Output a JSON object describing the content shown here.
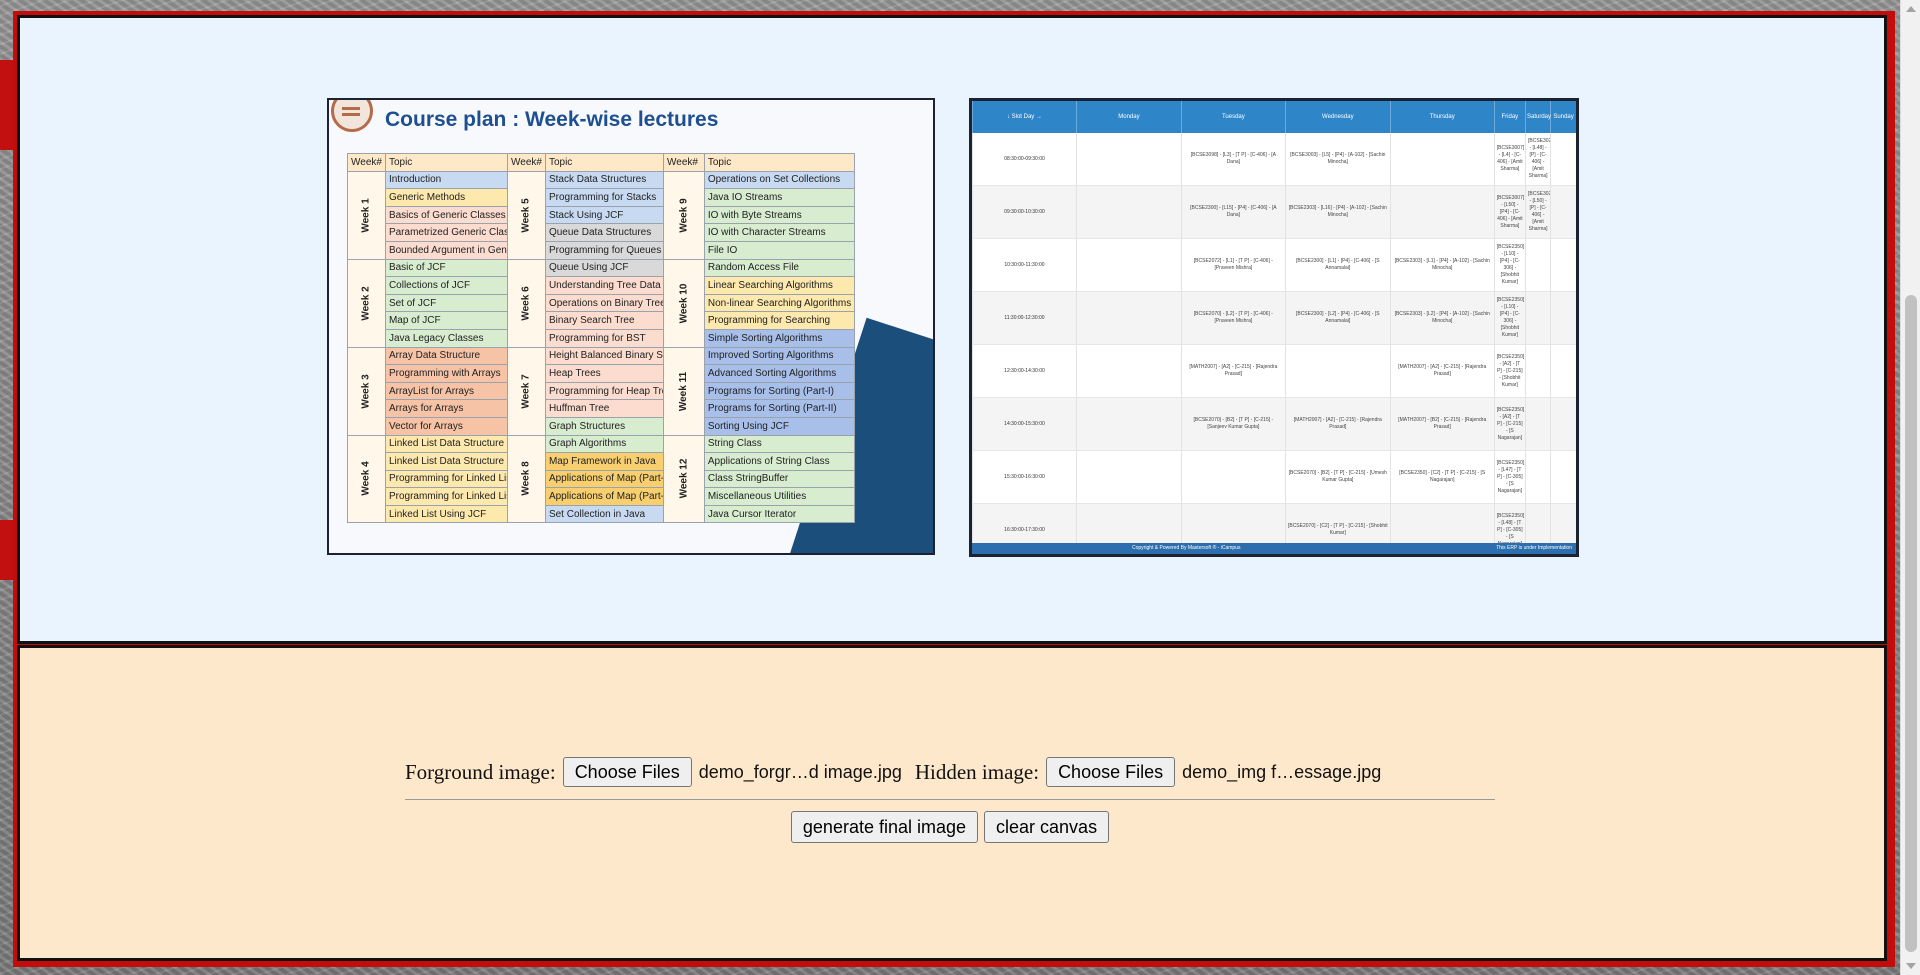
{
  "image_loader": {
    "foreground_label": "Forground image:",
    "hidden_label": "Hidden image:",
    "choose_files_label": "Choose Files",
    "foreground_file": "demo_forgr…d image.jpg",
    "hidden_file": "demo_img f…essage.jpg",
    "generate_label": "generate final image",
    "clear_label": "clear canvas"
  },
  "foreground_picture": {
    "title": "Course plan : Week-wise lectures",
    "header_week": "Week#",
    "header_topic": "Topic",
    "columns": [
      {
        "weeks": [
          {
            "label": "Week 1",
            "topics": [
              "Introduction",
              "Generic Methods",
              "Basics of Generic Classes",
              "Parametrized Generic Classes",
              "Bounded Argument in Generic Classes"
            ],
            "colors": [
              "c-blue",
              "c-yellow",
              "c-peach",
              "c-peach",
              "c-peach"
            ]
          },
          {
            "label": "Week 2",
            "topics": [
              "Basic of JCF",
              "Collections of JCF",
              "Set of JCF",
              "Map of JCF",
              "Java Legacy Classes"
            ],
            "colors": [
              "c-green",
              "c-green",
              "c-green",
              "c-green",
              "c-green"
            ]
          },
          {
            "label": "Week 3",
            "topics": [
              "Array Data Structure",
              "Programming with Arrays",
              "ArrayList for Arrays",
              "Arrays for Arrays",
              "Vector for Arrays"
            ],
            "colors": [
              "c-orange",
              "c-orange",
              "c-orange",
              "c-orange",
              "c-orange"
            ]
          },
          {
            "label": "Week 4",
            "topics": [
              "Linked List Data Structure (Part-I)",
              "Linked List Data Structure (Part-II)",
              "Programming for Linked List (Part-I)",
              "Programming for Linked List (Part-II)",
              "Linked List Using JCF"
            ],
            "colors": [
              "c-yellow",
              "c-yellow",
              "c-yellow",
              "c-yellow",
              "c-yellow"
            ]
          }
        ]
      },
      {
        "weeks": [
          {
            "label": "Week 5",
            "topics": [
              "Stack Data Structures",
              "Programming for Stacks",
              "Stack Using JCF",
              "Queue Data Structures",
              "Programming for Queues"
            ],
            "colors": [
              "c-blue",
              "c-blue",
              "c-blue",
              "c-gray",
              "c-gray"
            ]
          },
          {
            "label": "Week 6",
            "topics": [
              "Queue Using JCF",
              "Understanding Tree Data Structures",
              "Operations on Binary Trees",
              "Binary Search Tree",
              "Programming for BST"
            ],
            "colors": [
              "c-gray",
              "c-peach",
              "c-peach",
              "c-peach",
              "c-peach"
            ]
          },
          {
            "label": "Week 7",
            "topics": [
              "Height Balanced Binary Search Tree",
              "Heap Trees",
              "Programming for Heap Trees",
              "Huffman Tree",
              "Graph Structures"
            ],
            "colors": [
              "c-peach",
              "c-peach",
              "c-peach",
              "c-peach",
              "c-green"
            ]
          },
          {
            "label": "Week 8",
            "topics": [
              "Graph Algorithms",
              "Map Framework in Java",
              "Applications of Map (Part-I)",
              "Applications of Map (Part-II)",
              "Set Collection in Java"
            ],
            "colors": [
              "c-green",
              "c-gold",
              "c-gold",
              "c-gold",
              "c-blue"
            ]
          }
        ]
      },
      {
        "weeks": [
          {
            "label": "Week 9",
            "topics": [
              "Operations on Set Collections",
              "Java IO Streams",
              "IO with Byte Streams",
              "IO with Character Streams",
              "File IO"
            ],
            "colors": [
              "c-blue",
              "c-green",
              "c-green",
              "c-green",
              "c-green"
            ]
          },
          {
            "label": "Week 10",
            "topics": [
              "Random Access File",
              "Linear Searching Algorithms",
              "Non-linear Searching Algorithms",
              "Programming for Searching",
              "Simple Sorting Algorithms"
            ],
            "colors": [
              "c-green",
              "c-yellow",
              "c-yellow",
              "c-yellow",
              "c-royal"
            ]
          },
          {
            "label": "Week 11",
            "topics": [
              "Improved Sorting Algorithms",
              "Advanced Sorting Algorithms",
              "Programs for Sorting (Part-I)",
              "Programs for Sorting (Part-II)",
              "Sorting Using JCF"
            ],
            "colors": [
              "c-royal",
              "c-royal",
              "c-royal",
              "c-royal",
              "c-royal"
            ]
          },
          {
            "label": "Week 12",
            "topics": [
              "String Class",
              "Applications of String Class",
              "Class StringBuffer",
              "Miscellaneous Utilities",
              "Java Cursor Iterator"
            ],
            "colors": [
              "c-green",
              "c-green",
              "c-green",
              "c-green",
              "c-green"
            ]
          }
        ]
      }
    ]
  },
  "hidden_picture": {
    "headers": [
      "↓ Slot Day →",
      "Monday",
      "Tuesday",
      "Wednesday",
      "Thursday",
      "Friday",
      "Saturday",
      "Sunday"
    ],
    "rows": [
      [
        "08:30:00-09:30:00",
        "",
        "[BCSE3098] - [L3] - [T P] - [C-406] - [A Dana]",
        "[BCSE3003] - [L5] - [P4] - [A-102] - [Sachin Minocha]",
        "",
        "[BCSE3007] - [L4] - [C-406] - [Amit Sharma]",
        "[BCSE3020] - [L48] - [P] - [C-406] - [Amit Sharma]",
        ""
      ],
      [
        "09:30:00-10:30:00",
        "",
        "[BCSE2300] - [L15] - [P4] - [C-406] - [A Dana]",
        "[BCSE2303] - [L16] - [P4] - [A-102] - [Sachin Minocha]",
        "",
        "[BCSE3007] - [L50] - [P4] - [C-406] - [Amit Sharma]",
        "[BCSE3020] - [L50] - [P] - [C-406] - [Amit Sharma]",
        ""
      ],
      [
        "10:30:00-11:30:00",
        "",
        "[BCSE2072] - [L1] - [T P] - [C-406] - [Praveen Mishra]",
        "[BCSE2300] - [L1] - [P4] - [C-406] - [S Annamalai]",
        "[BCSE2303] - [L1] - [P4] - [A-102] - [Sachin Minocha]",
        "[BCSE2350] - [L10] - [P4] - [C-306] - [Shobhit Kumar]",
        "",
        ""
      ],
      [
        "11:30:00-12:30:00",
        "",
        "[BCSE2070] - [L2] - [T P] - [C-406] - [Praveen Mishra]",
        "[BCSE2300] - [L2] - [P4] - [C-406] - [S Annamalai]",
        "[BCSE2303] - [L2] - [P4] - [A-102] - [Sachin Minocha]",
        "[BCSE2350] - [L10] - [P4] - [C-306] - [Shobhit Kumar]",
        "",
        ""
      ],
      [
        "12:30:00-14:30:00",
        "",
        "[MATH2007] - [A2] - [C-215] - [Rajendra Prasad]",
        "",
        "[MATH2007] - [A2] - [C-215] - [Rajendra Prasad]",
        "[BCSE2350] - [A2] - [T P] - [C-215] - [Shobhit Kumar]",
        "",
        ""
      ],
      [
        "14:30:00-15:30:00",
        "",
        "[BCSE2070] - [B2] - [T P] - [C-215] - [Sanjeev Kumar Gupta]",
        "[MATH2007] - [A2] - [C-215] - [Rajendra Prasad]",
        "[MATH2007] - [B2] - [C-215] - [Rajendra Prasad]",
        "[BCSE2350] - [A2] - [T P] - [C-215] - [S Nagarajan]",
        "",
        ""
      ],
      [
        "15:30:00-16:30:00",
        "",
        "",
        "[BCSE2070] - [B2] - [T P] - [C-215] - [Umesh Kumar Gupta]",
        "[BCSE2350] - [C2] - [T P] - [C-215] - [S Nagarajan]",
        "[BCSE2350] - [L47] - [T P] - [C-305] - [S Nagarajan]",
        "",
        ""
      ],
      [
        "16:30:00-17:30:00",
        "",
        "",
        "[BCSE2070] - [C2] - [T P] - [C-215] - [Shobhit Kumar]",
        "",
        "[BCSE2350] - [L48] - [T P] - [C-305] - [S Nagarajan]",
        "",
        ""
      ]
    ],
    "footer_left": "Copyright & Powered By Mastersoft ® - iCampus",
    "footer_right": "This ERP is under Implementation"
  }
}
